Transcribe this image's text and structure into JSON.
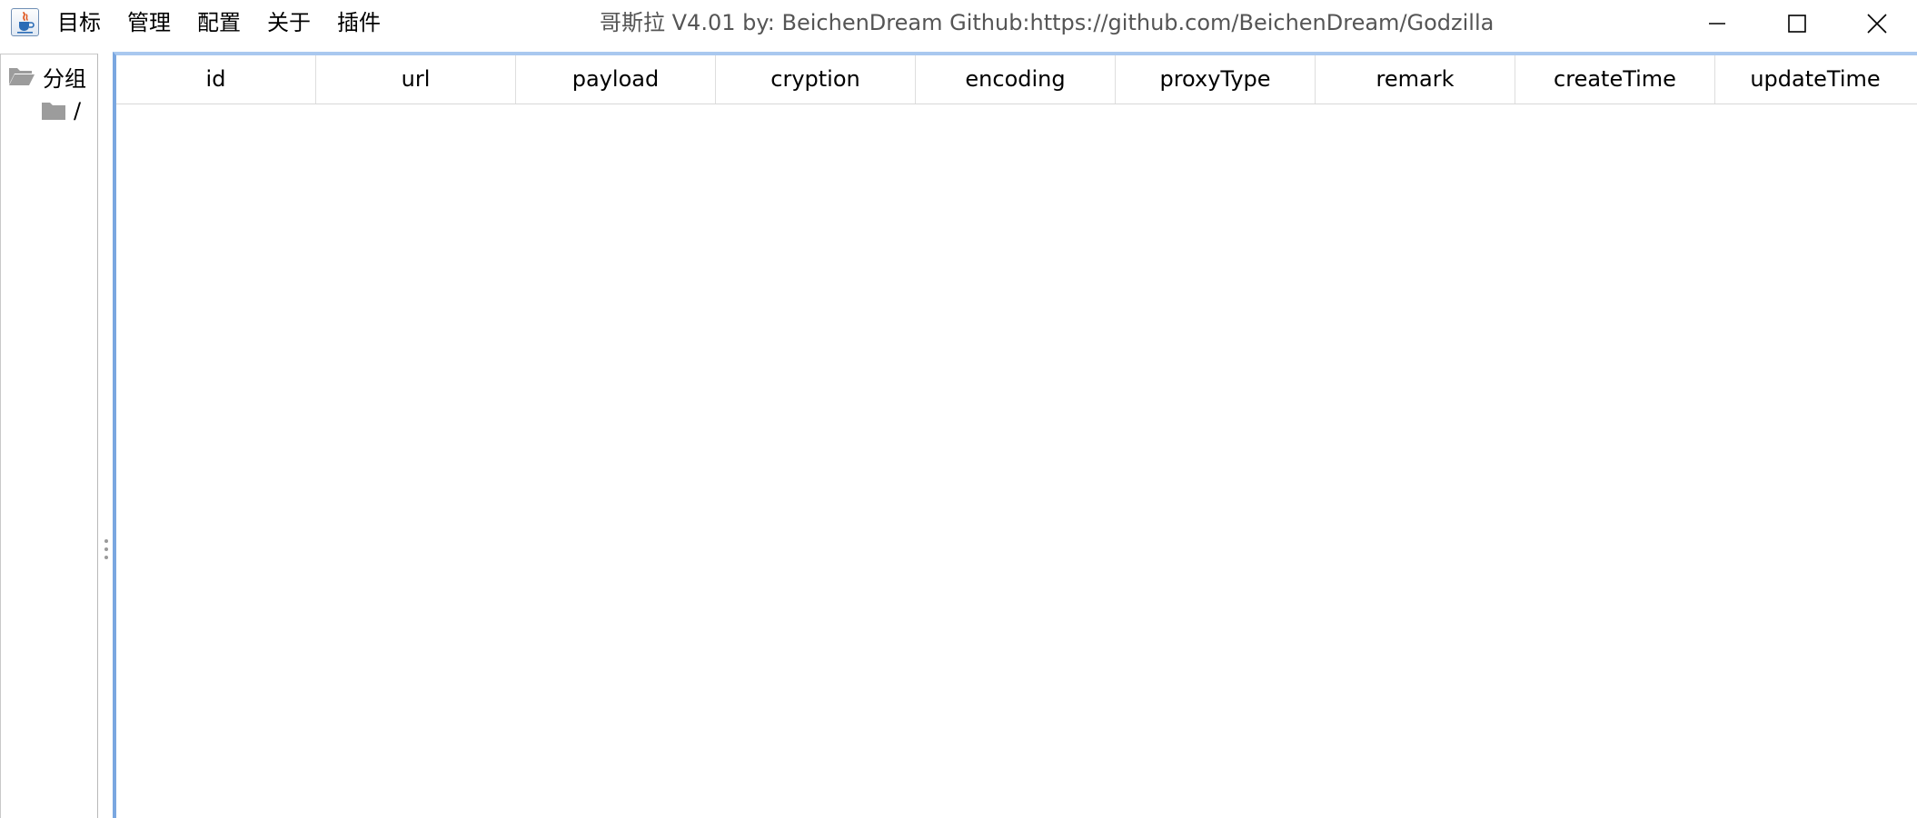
{
  "window": {
    "title": "哥斯拉   V4.01 by: BeichenDream Github:https://github.com/BeichenDream/Godzilla"
  },
  "app_icon": "java-coffee-cup-icon",
  "menu": [
    {
      "label": "目标"
    },
    {
      "label": "管理"
    },
    {
      "label": "配置"
    },
    {
      "label": "关于"
    },
    {
      "label": "插件"
    }
  ],
  "window_controls": [
    "minimize-icon",
    "maximize-icon",
    "close-icon"
  ],
  "tree": {
    "root": {
      "label": "分组",
      "icon": "folder-open-icon"
    },
    "children": [
      {
        "label": "/",
        "icon": "folder-icon"
      }
    ]
  },
  "table": {
    "columns": [
      "id",
      "url",
      "payload",
      "cryption",
      "encoding",
      "proxyType",
      "remark",
      "createTime",
      "updateTime"
    ],
    "rows": []
  },
  "colors": {
    "focus_border": "#7aa7e0",
    "title_text": "#555555",
    "folder_gray": "#9c9c9c"
  }
}
